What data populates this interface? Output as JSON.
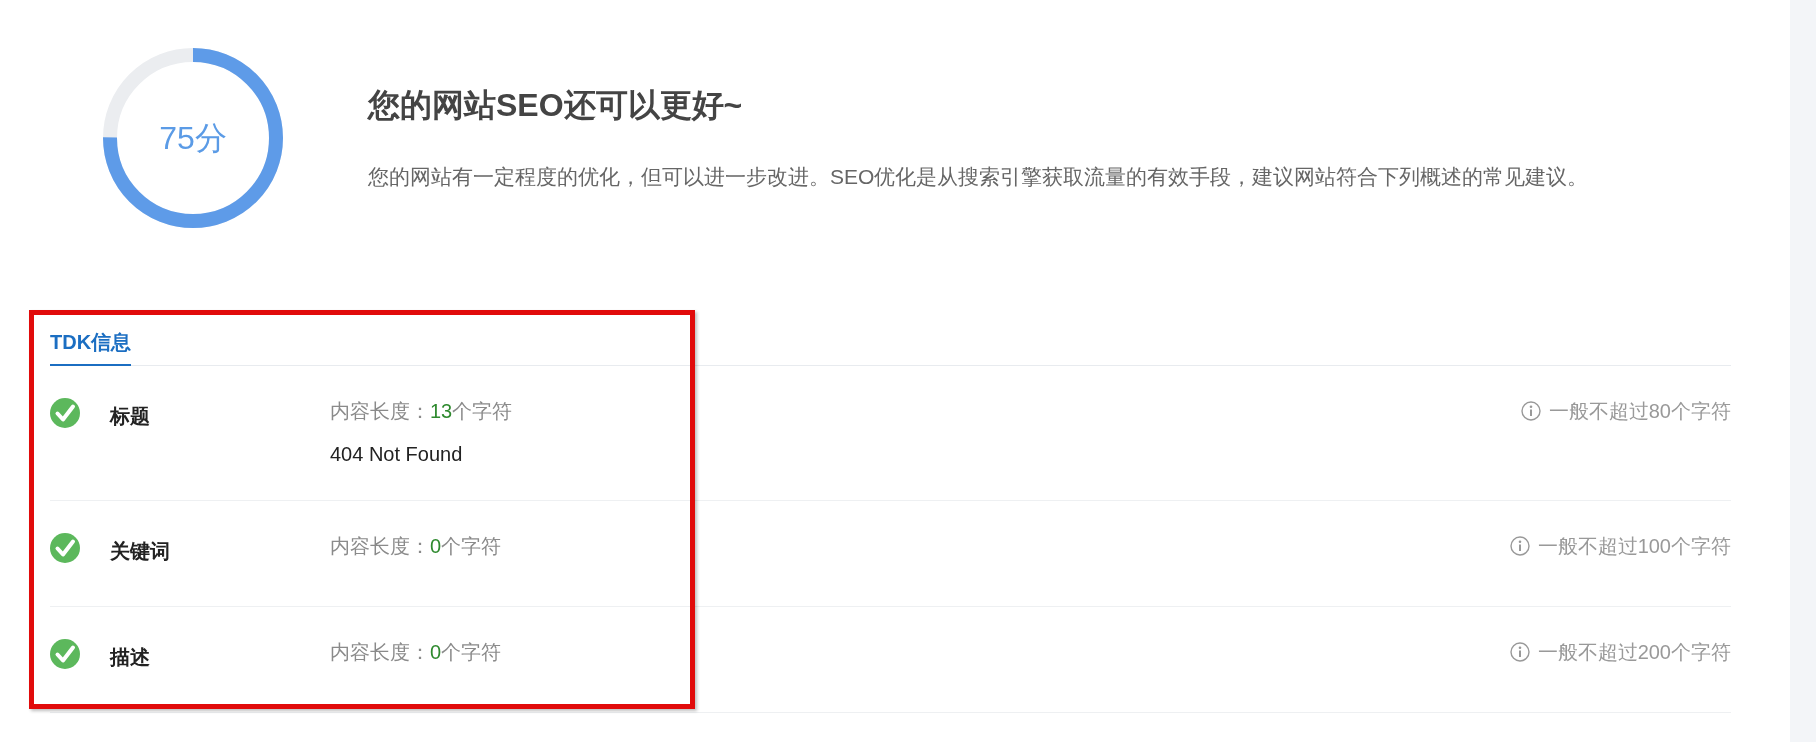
{
  "score": {
    "label": "75分",
    "level": 0.75
  },
  "summary": {
    "title": "您的网站SEO还可以更好~",
    "description": "您的网站有一定程度的优化，但可以进一步改进。SEO优化是从搜索引擎获取流量的有效手段，建议网站符合下列概述的常见建议。"
  },
  "tdk_section": {
    "highlighted": true,
    "tabs": [
      {
        "label": "TDK信息",
        "selected": true
      }
    ],
    "items": [
      {
        "name": "标题",
        "passed": true,
        "length_prefix": "内容长度：",
        "length": "13",
        "length_suffix": "个字符",
        "value": "404 Not Found",
        "hint": "一般不超过80个字符"
      },
      {
        "name": "关键词",
        "passed": true,
        "length_prefix": "内容长度：",
        "length": "0",
        "length_suffix": "个字符",
        "hint": "一般不超过100个字符"
      },
      {
        "name": "描述",
        "passed": true,
        "length_prefix": "内容长度：",
        "length": "0",
        "length_suffix": "个字符",
        "hint": "一般不超过200个字符"
      }
    ]
  }
}
